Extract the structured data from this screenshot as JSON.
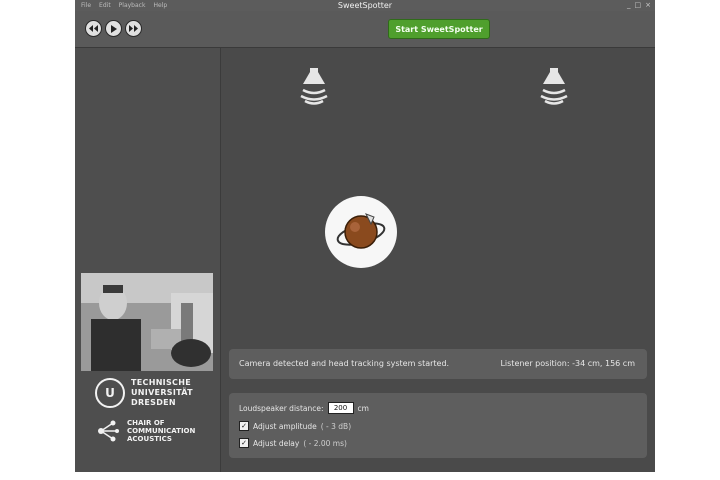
{
  "app": {
    "title": "SweetSpotter",
    "menu": [
      "File",
      "Edit",
      "Playback",
      "Help"
    ],
    "window_controls": [
      "_",
      "□",
      "×"
    ]
  },
  "toolbar": {
    "prev_icon": "skip-back-icon",
    "play_icon": "play-icon",
    "next_icon": "skip-forward-icon",
    "start_label": "Start SweetSpotter"
  },
  "branding": {
    "tud_line1": "TECHNISCHE",
    "tud_line2": "UNIVERSITÄT",
    "tud_line3": "DRESDEN",
    "chair_line1": "CHAIR OF",
    "chair_line2": "COMMUNICATION",
    "chair_line3": "ACOUSTICS"
  },
  "status": {
    "message": "Camera detected and head tracking system started.",
    "listener_position": "Listener position:   -34  cm,  156 cm"
  },
  "settings": {
    "distance_label": "Loudspeaker distance:",
    "distance_value": "200",
    "distance_unit": "cm",
    "adjust_amplitude_label": "Adjust amplitude",
    "adjust_amplitude_value": "( - 3 dB)",
    "adjust_amplitude_checked": true,
    "adjust_delay_label": "Adjust delay",
    "adjust_delay_value": "( - 2.00 ms)",
    "adjust_delay_checked": true
  },
  "colors": {
    "accent_green": "#4f9f2d",
    "background_dark": "#4a4a4a"
  }
}
